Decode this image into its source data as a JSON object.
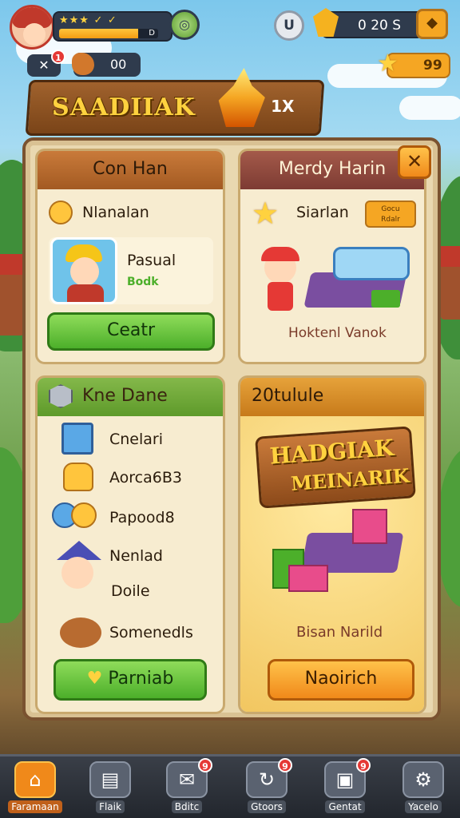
{
  "top_bar": {
    "level_stars": "★★★ ✓ ✓",
    "xp_value": "",
    "xp_end": "D",
    "xp_progress": 0.8,
    "u_button": "U",
    "gems": "0 20 S",
    "notif_count_x": "1",
    "close_chip": "✕",
    "resource_value": "00",
    "star_value": "99"
  },
  "banner": {
    "title": "SAADIIAK",
    "subtitle": "1X"
  },
  "cards": {
    "con_han": {
      "title": "Con Han",
      "row_label": "Nlanalan",
      "item_title": "Pasual",
      "item_sub": "Bodk",
      "button": "Ceatr"
    },
    "merdy_harin": {
      "title": "Merdy Harin",
      "row_label": "Siarlan",
      "tag": "Gocu\nRdalr",
      "caption": "Hoktenl Vanok"
    },
    "kne_dane": {
      "title": "Kne Dane",
      "items": [
        "Cnelari",
        "Aorca6B3",
        "Papood8",
        "Nenlad",
        "Doile",
        "Somenedls"
      ],
      "button": "Parniab"
    },
    "promo": {
      "title": "20tulule",
      "sale_line1": "HADGIAK",
      "sale_line2": "MEINARIK",
      "caption": "Bisan Narild",
      "button": "Naoirich"
    }
  },
  "nav": [
    {
      "label": "Faramaan",
      "icon": "home-icon",
      "badge": ""
    },
    {
      "label": "Flaik",
      "icon": "cards-icon",
      "badge": ""
    },
    {
      "label": "Bditc",
      "icon": "mail-icon",
      "badge": "9"
    },
    {
      "label": "Gtoors",
      "icon": "refresh-icon",
      "badge": "9"
    },
    {
      "label": "Gentat",
      "icon": "chest-icon",
      "badge": "9"
    },
    {
      "label": "Yacelo",
      "icon": "settings-icon",
      "badge": ""
    }
  ],
  "colors": {
    "accent_orange": "#f0891a",
    "accent_green": "#4caf2a",
    "board": "#e9d8b0"
  }
}
